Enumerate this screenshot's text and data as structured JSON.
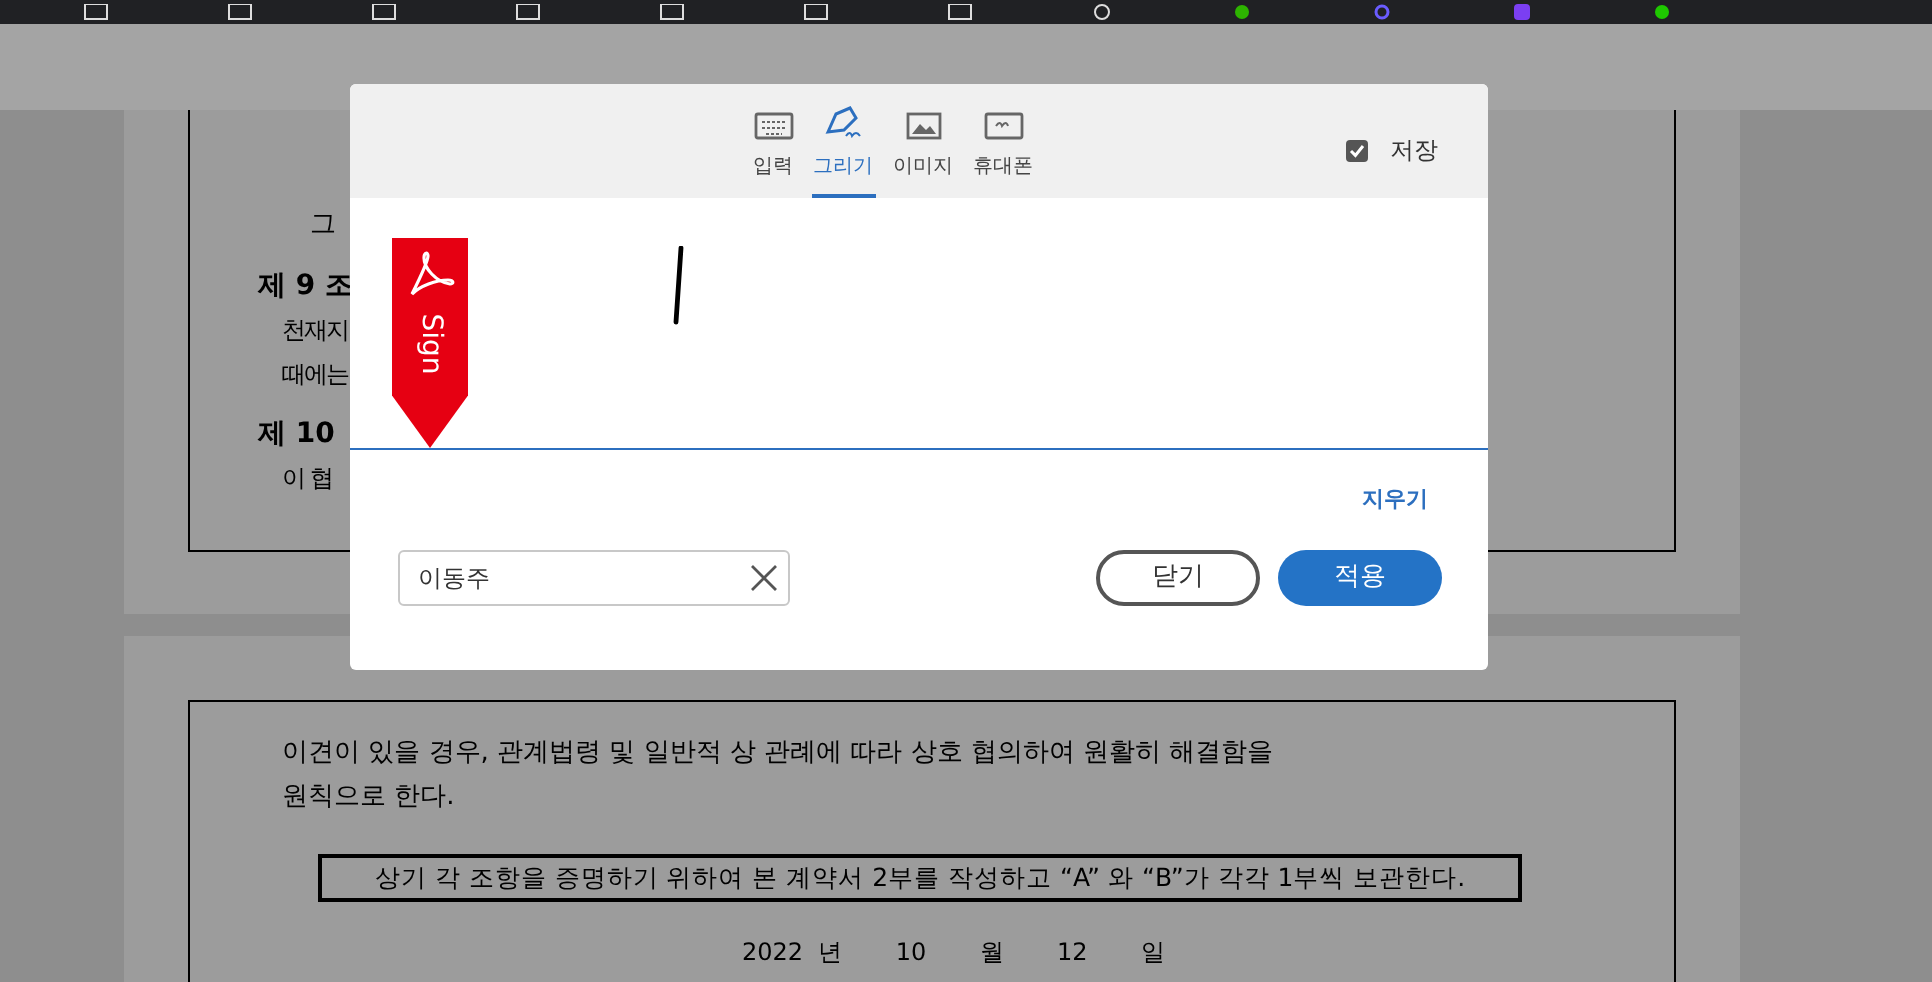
{
  "document": {
    "page_1": {
      "lines": [
        {
          "kind": "body",
          "text": "그"
        },
        {
          "kind": "heading",
          "text": "제 9 조"
        },
        {
          "kind": "body",
          "text": "천재지"
        },
        {
          "kind": "body",
          "text": "때에는"
        },
        {
          "kind": "heading",
          "text": "제 10"
        },
        {
          "kind": "body",
          "text": "이 협"
        }
      ]
    },
    "page_2": {
      "paragraph": [
        "이견이 있을 경우, 관계법령 및 일반적 상 관례에 따라 상호 협의하여 원활히 해결함을",
        "원칙으로 한다."
      ],
      "boxed_statement": "상기 각 조항을 증명하기 위하여 본 계약서 2부를 작성하고 “A” 와 “B”가 각각 1부씩 보관한다.",
      "date": "2022  년       10       월       12       일"
    }
  },
  "dialog": {
    "tabs": [
      {
        "kind": "keyboard",
        "label": "입력",
        "selected": false
      },
      {
        "kind": "pen",
        "label": "그리기",
        "selected": true
      },
      {
        "kind": "image",
        "label": "이미지",
        "selected": false
      },
      {
        "kind": "phone",
        "label": "휴대폰",
        "selected": false
      }
    ],
    "save": {
      "label": "저장",
      "checked": true
    },
    "sign_ribbon": {
      "label": "Sign"
    },
    "clear_link": "지우기",
    "name_field": {
      "value": "이동주"
    },
    "buttons": [
      {
        "kind": "secondary",
        "label": "닫기"
      },
      {
        "kind": "primary",
        "label": "적용"
      }
    ]
  }
}
